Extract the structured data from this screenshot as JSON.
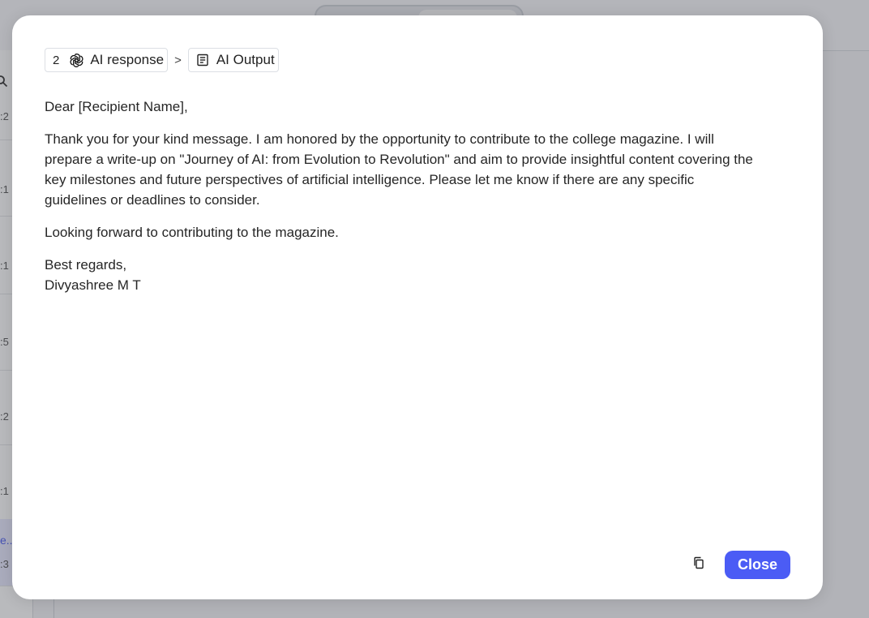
{
  "background": {
    "sidebar_rows": [
      {
        "time": ":2"
      },
      {
        "time": ":1"
      },
      {
        "time": ":1"
      },
      {
        "time": ":5"
      },
      {
        "time": ":2"
      },
      {
        "time": ":1"
      }
    ],
    "active_row": {
      "title": "e...",
      "time": ":3"
    }
  },
  "modal": {
    "breadcrumb": {
      "step_number": "2",
      "step_label": "AI response",
      "separator": ">",
      "output_label": "AI Output"
    },
    "content": {
      "greeting": "Dear [Recipient Name],",
      "body_lines": [
        "Thank you for your kind message. I am honored by the opportunity to contribute to the college magazine. I will",
        "prepare a write-up on \"Journey of AI: from Evolution to Revolution\" and aim to provide insightful content covering the",
        "key milestones and future perspectives of artificial intelligence. Please let me know if there are any specific",
        "guidelines or deadlines to consider."
      ],
      "closing_line": "Looking forward to contributing to the magazine.",
      "signoff": "Best regards,",
      "signature": "Divyashree M T"
    },
    "actions": {
      "copy_icon": "copy-icon",
      "close_label": "Close"
    }
  },
  "colors": {
    "accent": "#4b5cf5",
    "active_link": "#4a5cf0"
  }
}
